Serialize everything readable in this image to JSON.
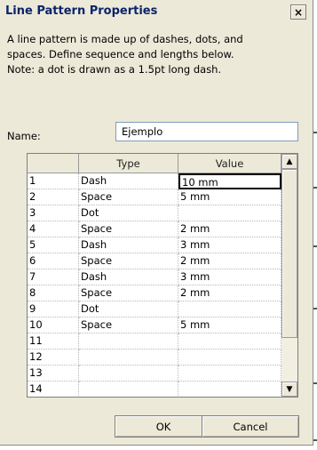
{
  "window": {
    "title": "Line Pattern Properties",
    "close_symbol": "×"
  },
  "description": [
    "A line pattern is made up of dashes, dots, and",
    "spaces. Define sequence and lengths below.",
    "Note: a dot is drawn as a 1.5pt long dash."
  ],
  "name_field": {
    "label": "Name:",
    "value": "Ejemplo"
  },
  "grid": {
    "columns": [
      "",
      "Type",
      "Value"
    ],
    "rows": [
      {
        "num": "1",
        "type": "Dash",
        "value": "10 mm"
      },
      {
        "num": "2",
        "type": "Space",
        "value": "5 mm"
      },
      {
        "num": "3",
        "type": "Dot",
        "value": ""
      },
      {
        "num": "4",
        "type": "Space",
        "value": "2 mm"
      },
      {
        "num": "5",
        "type": "Dash",
        "value": "3 mm"
      },
      {
        "num": "6",
        "type": "Space",
        "value": "2 mm"
      },
      {
        "num": "7",
        "type": "Dash",
        "value": "3 mm"
      },
      {
        "num": "8",
        "type": "Space",
        "value": "2 mm"
      },
      {
        "num": "9",
        "type": "Dot",
        "value": ""
      },
      {
        "num": "10",
        "type": "Space",
        "value": "5 mm"
      },
      {
        "num": "11",
        "type": "",
        "value": ""
      },
      {
        "num": "12",
        "type": "",
        "value": ""
      },
      {
        "num": "13",
        "type": "",
        "value": ""
      },
      {
        "num": "14",
        "type": "",
        "value": ""
      }
    ],
    "scroll_up_symbol": "▲",
    "scroll_down_symbol": "▼"
  },
  "buttons": {
    "ok": "OK",
    "cancel": "Cancel"
  }
}
